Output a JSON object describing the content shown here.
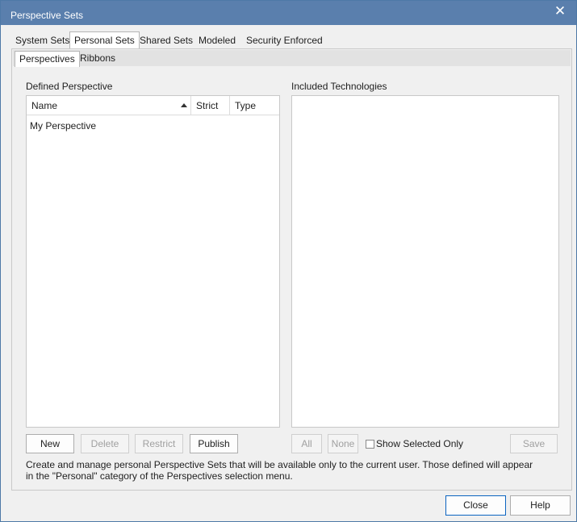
{
  "window": {
    "title": "Perspective Sets",
    "close_glyph": "✕"
  },
  "top_tabs": [
    "System Sets",
    "Personal Sets",
    "Shared Sets",
    "Modeled",
    "Security Enforced"
  ],
  "sub_tabs": [
    "Perspectives",
    "Ribbons"
  ],
  "left": {
    "label": "Defined  Perspective",
    "columns": [
      "Name",
      "Strict",
      "Type"
    ],
    "rows": [
      "My Perspective"
    ]
  },
  "right": {
    "label": "Included Technologies"
  },
  "buttons": {
    "new": "New",
    "delete": "Delete",
    "restrict": "Restrict",
    "publish": "Publish",
    "all": "All",
    "none": "None",
    "show_selected_only": "Show Selected Only",
    "save": "Save",
    "close": "Close",
    "help": "Help"
  },
  "description": "Create and manage personal Perspective Sets that will be available only to the current user. Those defined will appear in the \"Personal\" category of the Perspectives selection menu.",
  "icons": {
    "close": "close-icon",
    "sort": "sort-ascending-icon"
  },
  "colors": {
    "titlebar": "#5a7fad",
    "accent": "#0b64c0"
  }
}
